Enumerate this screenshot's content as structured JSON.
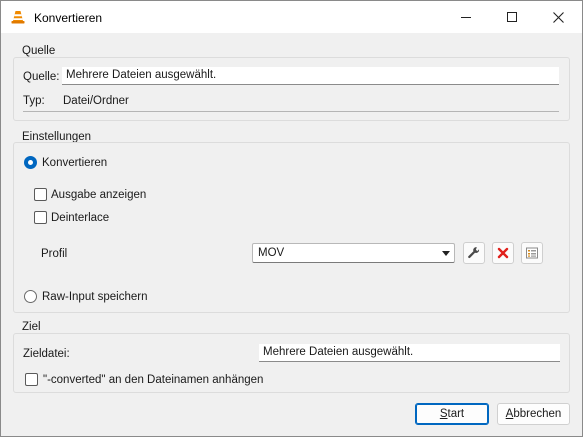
{
  "window": {
    "title": "Konvertieren"
  },
  "source": {
    "group_label": "Quelle",
    "source_label": "Quelle:",
    "source_value": "Mehrere Dateien ausgewählt.",
    "type_label": "Typ:",
    "type_value": "Datei/Ordner"
  },
  "settings": {
    "group_label": "Einstellungen",
    "convert_label": "Konvertieren",
    "convert_checked": true,
    "show_output_label": "Ausgabe anzeigen",
    "show_output_checked": false,
    "deinterlace_label": "Deinterlace",
    "deinterlace_checked": false,
    "profile_label": "Profil",
    "profile_value": "MOV",
    "raw_input_label": "Raw-Input speichern",
    "raw_input_checked": false
  },
  "target": {
    "group_label": "Ziel",
    "dest_label": "Zieldatei:",
    "dest_value": "Mehrere Dateien ausgewählt.",
    "append_label": "\"-converted\" an den Dateinamen anhängen",
    "append_checked": false
  },
  "buttons": {
    "start_first": "S",
    "start_rest": "tart",
    "cancel_first": "A",
    "cancel_rest": "bbrechen"
  },
  "colors": {
    "accent": "#0067c0",
    "delete_red": "#e0201b",
    "vlc_orange": "#f08a00"
  },
  "icons": {
    "app": "vlc-cone-icon",
    "edit_profile": "wrench-icon",
    "delete_profile": "red-x-icon",
    "new_profile": "profile-grid-icon"
  }
}
